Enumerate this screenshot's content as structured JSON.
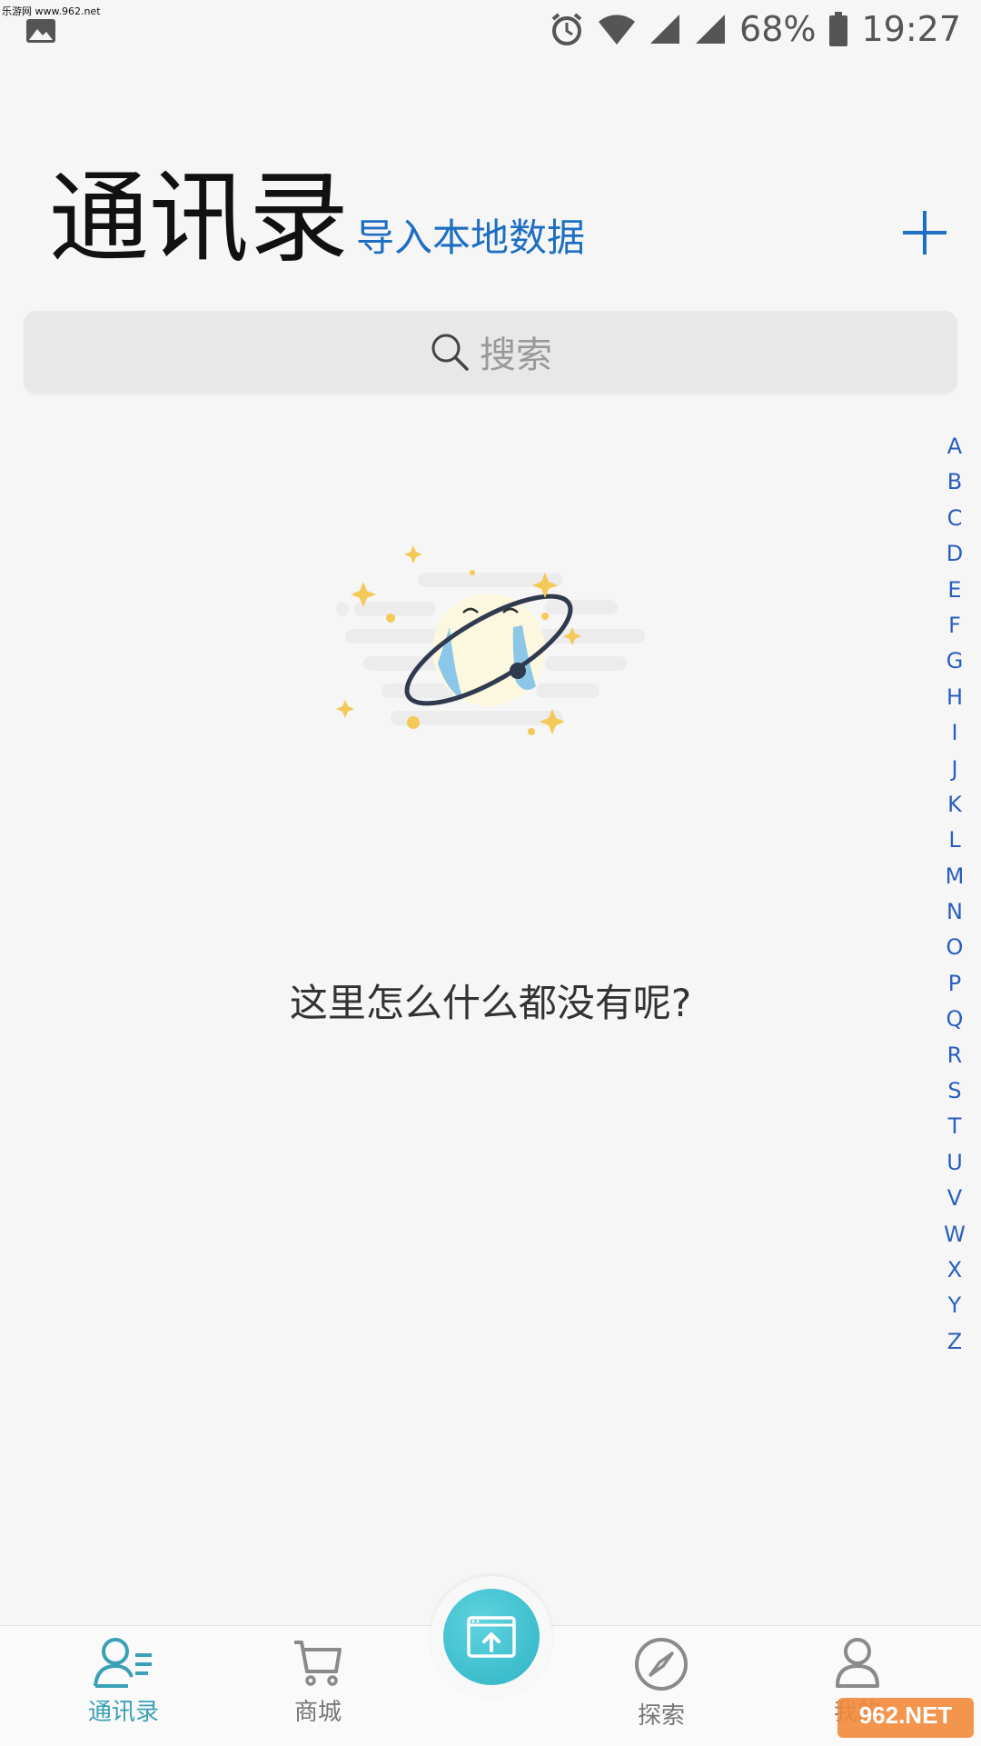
{
  "status_bar": {
    "watermark": "乐游网 www.962.net",
    "battery": "68%",
    "time": "19:27",
    "icons": [
      "gallery-icon",
      "alarm-icon",
      "wifi-icon",
      "signal-icon",
      "battery-icon"
    ]
  },
  "header": {
    "title": "通讯录",
    "import_link": "导入本地数据",
    "add_icon": "plus-icon"
  },
  "search": {
    "placeholder": "搜索",
    "icon": "search-icon"
  },
  "empty_state": {
    "illustration": "crying-planet-icon",
    "message": "这里怎么什么都没有呢?"
  },
  "index_bar": {
    "letters": [
      "A",
      "B",
      "C",
      "D",
      "E",
      "F",
      "G",
      "H",
      "I",
      "J",
      "K",
      "L",
      "M",
      "N",
      "O",
      "P",
      "Q",
      "R",
      "S",
      "T",
      "U",
      "V",
      "W",
      "X",
      "Y",
      "Z"
    ]
  },
  "bottom_nav": {
    "items": [
      {
        "label": "通讯录",
        "icon": "contacts-icon",
        "active": true
      },
      {
        "label": "商城",
        "icon": "cart-icon",
        "active": false
      },
      {
        "label": "",
        "icon": "upload-icon",
        "active": false
      },
      {
        "label": "探索",
        "icon": "compass-icon",
        "active": false
      },
      {
        "label": "我的",
        "icon": "profile-icon",
        "active": false
      }
    ]
  },
  "overlay_logo": "962.NET 乐游网",
  "colors": {
    "accent_blue": "#1e6fc2",
    "active_tab": "#3aa0b5",
    "center_button": "#2fb3c5",
    "background": "#f6f6f6"
  }
}
